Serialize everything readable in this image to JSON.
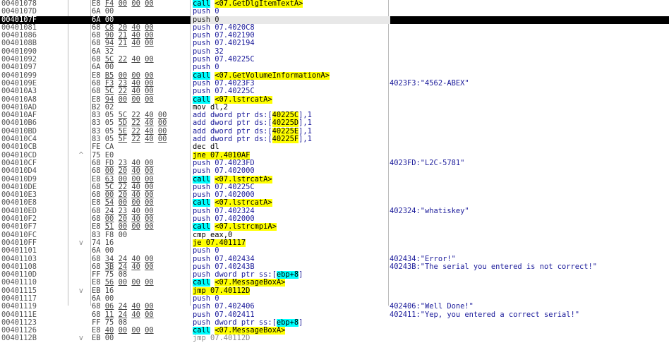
{
  "colors": {
    "call_hl": "#00ffff",
    "target_hl": "#ffff00",
    "selected_row": "#000000"
  },
  "selected_index": 2,
  "rows": [
    {
      "addr": "00401078",
      "gutter": "",
      "bytes": "E8 F4 00 00 00",
      "kind": "call",
      "parts": [
        "call",
        " ",
        "<07.GetDlgItemTextA>"
      ],
      "comment": ""
    },
    {
      "addr": "0040107D",
      "gutter": "",
      "bytes": "6A 00",
      "kind": "push",
      "parts": [
        "push 0"
      ],
      "comment": ""
    },
    {
      "addr": "0040107F",
      "gutter": "",
      "bytes": "6A 00",
      "kind": "push",
      "parts": [
        "push 0"
      ],
      "comment": ""
    },
    {
      "addr": "00401081",
      "gutter": "",
      "bytes": "68 C8 20 40 00",
      "kind": "push",
      "parts": [
        "push 07.4020C8"
      ],
      "comment": ""
    },
    {
      "addr": "00401086",
      "gutter": "",
      "bytes": "68 90 21 40 00",
      "kind": "push",
      "parts": [
        "push 07.402190"
      ],
      "comment": ""
    },
    {
      "addr": "0040108B",
      "gutter": "",
      "bytes": "68 94 21 40 00",
      "kind": "push",
      "parts": [
        "push 07.402194"
      ],
      "comment": ""
    },
    {
      "addr": "00401090",
      "gutter": "",
      "bytes": "6A 32",
      "kind": "push",
      "parts": [
        "push 32"
      ],
      "comment": ""
    },
    {
      "addr": "00401092",
      "gutter": "",
      "bytes": "68 5C 22 40 00",
      "kind": "push",
      "parts": [
        "push 07.40225C"
      ],
      "comment": ""
    },
    {
      "addr": "00401097",
      "gutter": "",
      "bytes": "6A 00",
      "kind": "push",
      "parts": [
        "push 0"
      ],
      "comment": ""
    },
    {
      "addr": "00401099",
      "gutter": "",
      "bytes": "E8 B5 00 00 00",
      "kind": "call",
      "parts": [
        "call",
        " ",
        "<07.GetVolumeInformationA>"
      ],
      "comment": ""
    },
    {
      "addr": "0040109E",
      "gutter": "",
      "bytes": "68 F3 23 40 00",
      "kind": "push",
      "parts": [
        "push 07.4023F3"
      ],
      "comment": "4023F3:\"4562-ABEX\""
    },
    {
      "addr": "004010A3",
      "gutter": "",
      "bytes": "68 5C 22 40 00",
      "kind": "push",
      "parts": [
        "push 07.40225C"
      ],
      "comment": ""
    },
    {
      "addr": "004010A8",
      "gutter": "",
      "bytes": "E8 94 00 00 00",
      "kind": "call",
      "parts": [
        "call",
        " ",
        "<07.lstrcatA>"
      ],
      "comment": ""
    },
    {
      "addr": "004010AD",
      "gutter": "",
      "bytes": "B2 02",
      "kind": "plain",
      "parts": [
        "mov dl,2"
      ],
      "comment": ""
    },
    {
      "addr": "004010AF",
      "gutter": "",
      "bytes": "83 05 5C 22 40 00",
      "kind": "mem",
      "parts": [
        "add dword ptr ds:[",
        "40225C",
        "],1"
      ],
      "comment": ""
    },
    {
      "addr": "004010B6",
      "gutter": "",
      "bytes": "83 05 5D 22 40 00",
      "kind": "mem",
      "parts": [
        "add dword ptr ds:[",
        "40225D",
        "],1"
      ],
      "comment": ""
    },
    {
      "addr": "004010BD",
      "gutter": "",
      "bytes": "83 05 5E 22 40 00",
      "kind": "mem",
      "parts": [
        "add dword ptr ds:[",
        "40225E",
        "],1"
      ],
      "comment": ""
    },
    {
      "addr": "004010C4",
      "gutter": "",
      "bytes": "83 05 5F 22 40 00",
      "kind": "mem",
      "parts": [
        "add dword ptr ds:[",
        "40225F",
        "],1"
      ],
      "comment": ""
    },
    {
      "addr": "004010CB",
      "gutter": "",
      "bytes": "FE CA",
      "kind": "plain",
      "parts": [
        "dec dl"
      ],
      "comment": ""
    },
    {
      "addr": "004010CD",
      "gutter": "^",
      "bytes": "75 E0",
      "kind": "jmp",
      "parts": [
        "jne 07.4010AF"
      ],
      "comment": ""
    },
    {
      "addr": "004010CF",
      "gutter": "",
      "bytes": "68 FD 23 40 00",
      "kind": "push",
      "parts": [
        "push 07.4023FD"
      ],
      "comment": "4023FD:\"L2C-5781\""
    },
    {
      "addr": "004010D4",
      "gutter": "",
      "bytes": "68 00 20 40 00",
      "kind": "push",
      "parts": [
        "push 07.402000"
      ],
      "comment": ""
    },
    {
      "addr": "004010D9",
      "gutter": "",
      "bytes": "E8 63 00 00 00",
      "kind": "call",
      "parts": [
        "call",
        " ",
        "<07.lstrcatA>"
      ],
      "comment": ""
    },
    {
      "addr": "004010DE",
      "gutter": "",
      "bytes": "68 5C 22 40 00",
      "kind": "push",
      "parts": [
        "push 07.40225C"
      ],
      "comment": ""
    },
    {
      "addr": "004010E3",
      "gutter": "",
      "bytes": "68 00 20 40 00",
      "kind": "push",
      "parts": [
        "push 07.402000"
      ],
      "comment": ""
    },
    {
      "addr": "004010E8",
      "gutter": "",
      "bytes": "E8 54 00 00 00",
      "kind": "call",
      "parts": [
        "call",
        " ",
        "<07.lstrcatA>"
      ],
      "comment": ""
    },
    {
      "addr": "004010ED",
      "gutter": "",
      "bytes": "68 24 23 40 00",
      "kind": "push",
      "parts": [
        "push 07.402324"
      ],
      "comment": "402324:\"whatiskey\""
    },
    {
      "addr": "004010F2",
      "gutter": "",
      "bytes": "68 00 20 40 00",
      "kind": "push",
      "parts": [
        "push 07.402000"
      ],
      "comment": ""
    },
    {
      "addr": "004010F7",
      "gutter": "",
      "bytes": "E8 51 00 00 00",
      "kind": "call",
      "parts": [
        "call",
        " ",
        "<07.lstrcmpiA>"
      ],
      "comment": ""
    },
    {
      "addr": "004010FC",
      "gutter": "",
      "bytes": "83 F8 00",
      "kind": "plain",
      "parts": [
        "cmp eax,0"
      ],
      "comment": ""
    },
    {
      "addr": "004010FF",
      "gutter": "v",
      "bytes": "74 16",
      "kind": "jmp",
      "parts": [
        "je 07.401117"
      ],
      "comment": ""
    },
    {
      "addr": "00401101",
      "gutter": "",
      "bytes": "6A 00",
      "kind": "push",
      "parts": [
        "push 0"
      ],
      "comment": ""
    },
    {
      "addr": "00401103",
      "gutter": "",
      "bytes": "68 34 24 40 00",
      "kind": "push",
      "parts": [
        "push 07.402434"
      ],
      "comment": "402434:\"Error!\""
    },
    {
      "addr": "00401108",
      "gutter": "",
      "bytes": "68 3B 24 40 00",
      "kind": "push",
      "parts": [
        "push 07.40243B"
      ],
      "comment": "40243B:\"The serial you entered is not correct!\""
    },
    {
      "addr": "0040110D",
      "gutter": "",
      "bytes": "FF 75 08",
      "kind": "reg",
      "parts": [
        "push dword ptr ss:[",
        "ebp+8",
        "]"
      ],
      "comment": ""
    },
    {
      "addr": "00401110",
      "gutter": "",
      "bytes": "E8 56 00 00 00",
      "kind": "call",
      "parts": [
        "call",
        " ",
        "<07.MessageBoxA>"
      ],
      "comment": ""
    },
    {
      "addr": "00401115",
      "gutter": "v",
      "bytes": "EB 16",
      "kind": "jmp",
      "parts": [
        "jmp 07.40112D"
      ],
      "comment": ""
    },
    {
      "addr": "00401117",
      "gutter": "",
      "bytes": "6A 00",
      "kind": "push",
      "parts": [
        "push 0"
      ],
      "comment": ""
    },
    {
      "addr": "00401119",
      "gutter": "",
      "bytes": "68 06 24 40 00",
      "kind": "push",
      "parts": [
        "push 07.402406"
      ],
      "comment": "402406:\"Well Done!\""
    },
    {
      "addr": "0040111E",
      "gutter": "",
      "bytes": "68 11 24 40 00",
      "kind": "push",
      "parts": [
        "push 07.402411"
      ],
      "comment": "402411:\"Yep, you entered a correct serial!\""
    },
    {
      "addr": "00401123",
      "gutter": "",
      "bytes": "FF 75 08",
      "kind": "reg",
      "parts": [
        "push dword ptr ss:[",
        "ebp+8",
        "]"
      ],
      "comment": ""
    },
    {
      "addr": "00401126",
      "gutter": "",
      "bytes": "E8 40 00 00 00",
      "kind": "call",
      "parts": [
        "call",
        " ",
        "<07.MessageBoxA>"
      ],
      "comment": ""
    },
    {
      "addr": "0040112B",
      "gutter": "v",
      "bytes": "EB 00",
      "kind": "jdim",
      "parts": [
        "jmp 07.40112D"
      ],
      "comment": ""
    }
  ]
}
